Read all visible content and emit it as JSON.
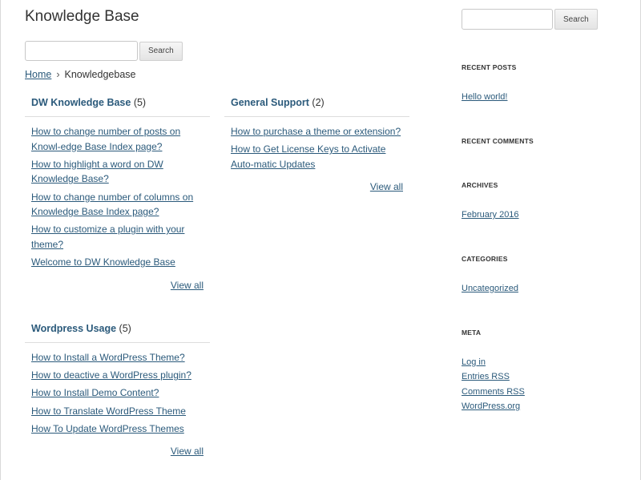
{
  "page": {
    "title": "Knowledge Base"
  },
  "main_search": {
    "button_label": "Search",
    "placeholder": ""
  },
  "sidebar_search": {
    "button_label": "Search",
    "placeholder": ""
  },
  "breadcrumb": {
    "home": "Home",
    "separator": "›",
    "current": "Knowledgebase"
  },
  "sections": [
    {
      "name": "DW Knowledge Base",
      "count": "(5)",
      "articles": [
        "How to change number of posts on Knowl-edge Base Index page?",
        "How to highlight a word on DW Knowledge Base?",
        "How to change number of columns on Knowledge Base Index page?",
        "How to customize a plugin with your theme?",
        "Welcome to DW Knowledge Base"
      ],
      "view_all": "View all"
    },
    {
      "name": "General Support",
      "count": "(2)",
      "articles": [
        "How to purchase a theme or extension?",
        "How to Get License Keys to Activate Auto-matic Updates"
      ],
      "view_all": "View all"
    },
    {
      "name": "Wordpress Usage",
      "count": "(5)",
      "articles": [
        "How to Install a WordPress Theme?",
        "How to deactive a WordPress plugin?",
        "How to Install Demo Content?",
        "How to Translate WordPress Theme",
        "How To Update WordPress Themes"
      ],
      "view_all": "View all"
    }
  ],
  "sidebar": {
    "recent_posts": {
      "title": "RECENT POSTS",
      "items": [
        "Hello world!"
      ]
    },
    "recent_comments": {
      "title": "RECENT COMMENTS"
    },
    "archives": {
      "title": "ARCHIVES",
      "items": [
        "February 2016"
      ]
    },
    "categories": {
      "title": "CATEGORIES",
      "items": [
        "Uncategorized"
      ]
    },
    "meta": {
      "title": "META",
      "items": [
        "Log in",
        "Entries RSS",
        "Comments RSS",
        "WordPress.org"
      ]
    }
  },
  "colors": {
    "link": "#2b5a7b",
    "text": "#333333",
    "divider": "#dddddd"
  }
}
